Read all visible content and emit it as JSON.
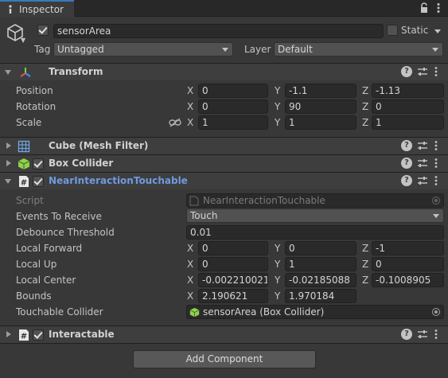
{
  "tab": {
    "label": "Inspector",
    "icon": "info-icon"
  },
  "header": {
    "name": "sensorArea",
    "static_label": "Static",
    "tag_label": "Tag",
    "tag_value": "Untagged",
    "layer_label": "Layer",
    "layer_value": "Default"
  },
  "transform": {
    "title": "Transform",
    "position_label": "Position",
    "rotation_label": "Rotation",
    "scale_label": "Scale",
    "position": [
      "0",
      "-1.1",
      "-1.13"
    ],
    "rotation": [
      "0",
      "90",
      "0"
    ],
    "scale": [
      "1",
      "1",
      "1"
    ]
  },
  "axes": {
    "x": "X",
    "y": "Y",
    "z": "Z"
  },
  "components": {
    "mesh_filter": "Cube (Mesh Filter)",
    "box_collider": "Box Collider",
    "near": "NearInteractionTouchable",
    "interactable": "Interactable"
  },
  "near": {
    "script_label": "Script",
    "script_value": "NearInteractionTouchable",
    "events_label": "Events To Receive",
    "events_value": "Touch",
    "debounce_label": "Debounce Threshold",
    "debounce_value": "0.01",
    "local_forward_label": "Local Forward",
    "local_forward": [
      "0",
      "0",
      "-1"
    ],
    "local_up_label": "Local Up",
    "local_up": [
      "0",
      "1",
      "0"
    ],
    "local_center_label": "Local Center",
    "local_center": [
      "-0.002210021",
      "-0.02185088",
      "-0.1008905"
    ],
    "bounds_label": "Bounds",
    "bounds": [
      "2.190621",
      "1.970184"
    ],
    "collider_label": "Touchable Collider",
    "collider_value": "sensorArea (Box Collider)"
  },
  "add_component_label": "Add Component",
  "colors": {
    "accent": "#3a79bb",
    "link": "#6f9ae0",
    "panel": "#383838",
    "field": "#2a2a2a"
  }
}
